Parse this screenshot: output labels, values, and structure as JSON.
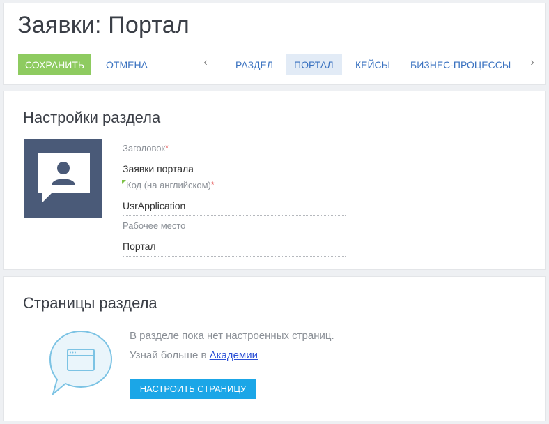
{
  "header": {
    "title": "Заявки: Портал",
    "save_label": "СОХРАНИТЬ",
    "cancel_label": "ОТМЕНА",
    "tabs": [
      {
        "label": "РАЗДЕЛ",
        "active": false
      },
      {
        "label": "ПОРТАЛ",
        "active": true
      },
      {
        "label": "КЕЙСЫ",
        "active": false
      },
      {
        "label": "БИЗНЕС-ПРОЦЕССЫ",
        "active": false
      }
    ],
    "prev_icon": "chevron-left-icon",
    "next_icon": "chevron-right-icon"
  },
  "settings": {
    "title": "Настройки раздела",
    "icon": "user-chat-icon",
    "fields": [
      {
        "label": "Заголовок",
        "required": "*",
        "value": "Заявки портала"
      },
      {
        "label": "Код (на английском)",
        "required": "*",
        "value": "UsrApplication"
      },
      {
        "label": "Рабочее место",
        "required": "",
        "value": "Портал"
      }
    ]
  },
  "pages": {
    "title": "Страницы раздела",
    "empty_line1": "В разделе пока нет настроенных страниц.",
    "empty_line2_prefix": "Узнай больше в ",
    "academy_link": "Академии",
    "setup_button": "НАСТРОИТЬ СТРАНИЦУ",
    "illustration_icon": "browser-window-bubble-icon"
  },
  "colors": {
    "save_green": "#8ecb60",
    "link_blue": "#3a72c0",
    "setup_blue": "#1ba6e7",
    "avatar_bg": "#4a5a78",
    "required_red": "#e23b3b"
  }
}
